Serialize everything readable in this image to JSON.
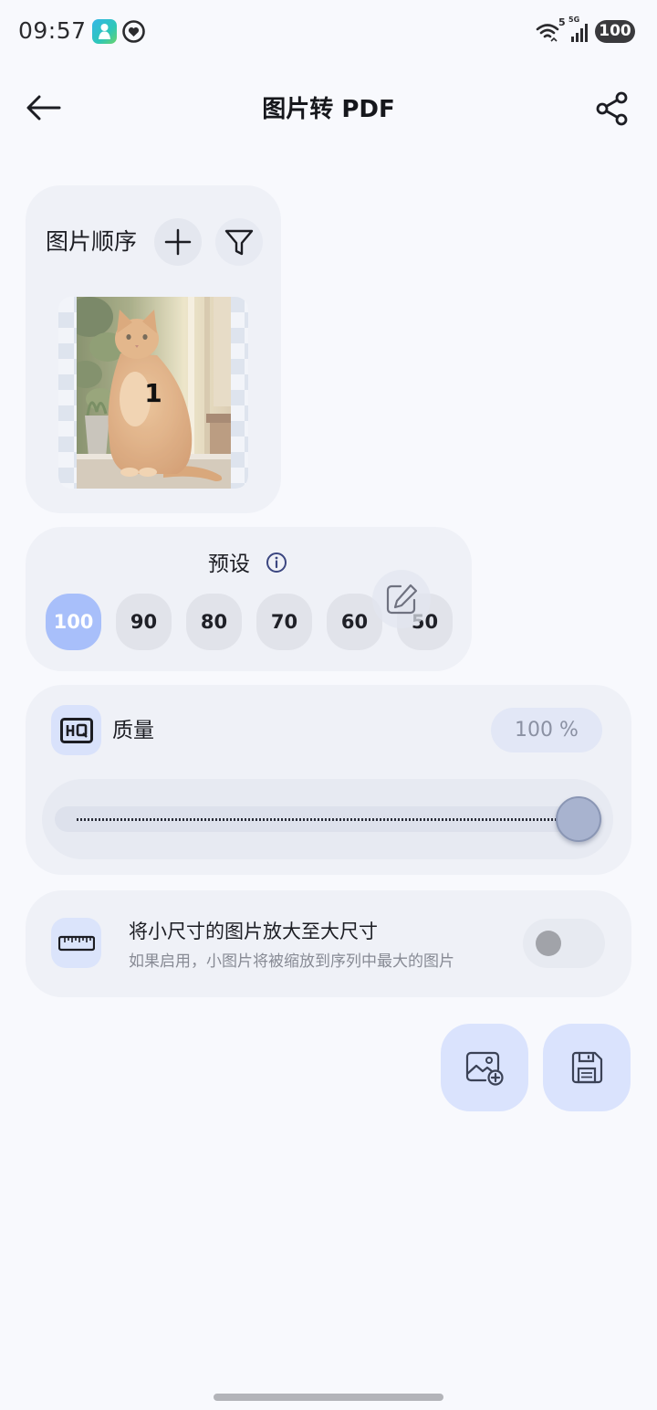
{
  "status_bar": {
    "time": "09:57",
    "wifi_badge": "5",
    "network_type": "5G",
    "battery": "100"
  },
  "header": {
    "title": "图片转 PDF",
    "back_icon": "arrow-left-icon",
    "share_icon": "share-icon"
  },
  "image_order": {
    "title": "图片顺序",
    "add_icon": "plus-icon",
    "filter_icon": "filter-icon",
    "images": [
      {
        "index": "1"
      }
    ]
  },
  "presets": {
    "title": "预设",
    "info_icon": "info-icon",
    "edit_icon": "edit-icon",
    "options": [
      "100",
      "90",
      "80",
      "70",
      "60",
      "50"
    ],
    "selected_index": 0
  },
  "quality": {
    "title": "质量",
    "icon": "hq-icon",
    "value_label": "100 %",
    "value_percent": 100
  },
  "upscale": {
    "title": "将小尺寸的图片放大至大尺寸",
    "subtitle": "如果启用，小图片将被缩放到序列中最大的图片",
    "icon": "ruler-icon",
    "enabled": false
  },
  "actions": {
    "add_image_icon": "image-plus-icon",
    "save_icon": "save-icon"
  },
  "colors": {
    "background": "#f8f9fd",
    "card": "#eff1f7",
    "accent": "#a8bffa",
    "icon_tile": "#d9e2fb",
    "preset_inactive": "#e1e3ea",
    "toggle_knob_off": "#a1a3a9"
  }
}
